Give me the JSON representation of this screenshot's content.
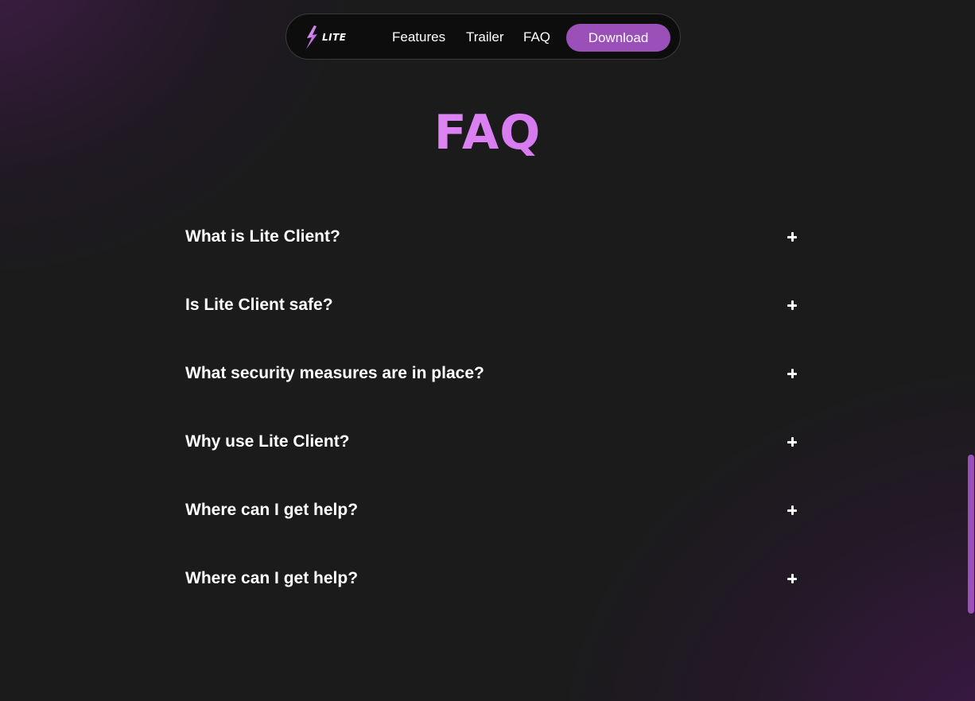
{
  "nav": {
    "logo_text": "LITE",
    "links": [
      "Features",
      "Trailer",
      "FAQ"
    ],
    "download_label": "Download"
  },
  "faq": {
    "title": "FAQ",
    "items": [
      "What is Lite Client?",
      "Is Lite Client safe?",
      "What security measures are in place?",
      "Why use Lite Client?",
      "Where can I get help?",
      "Where can I get help?"
    ],
    "expand_icon": "plus-icon"
  },
  "colors": {
    "accent": "#9b4fb8",
    "title_gradient_start": "#f0b2ff",
    "title_gradient_end": "#c45ee6",
    "background": "#1b1b1c",
    "nav_background": "#0d0d0e"
  }
}
